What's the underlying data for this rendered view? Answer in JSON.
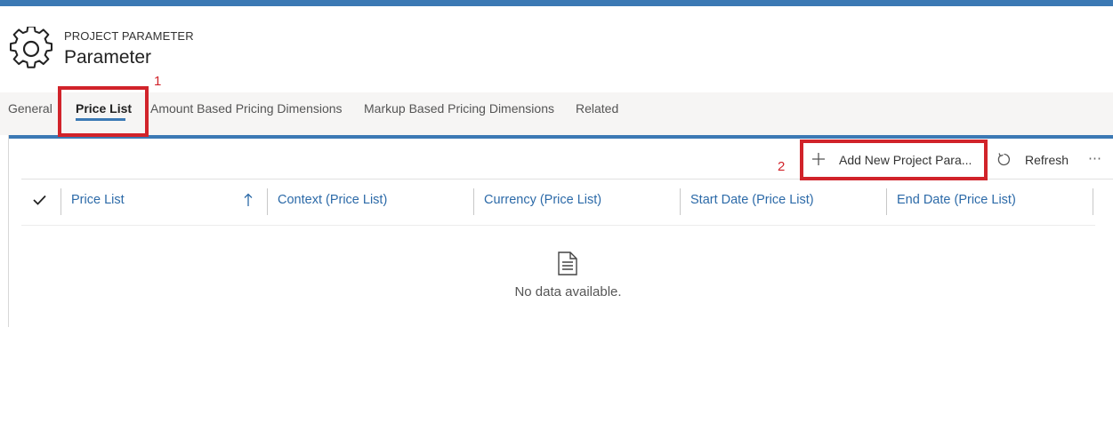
{
  "header": {
    "entity_type": "PROJECT PARAMETER",
    "entity_name": "Parameter",
    "icon": "gear-icon"
  },
  "tabs": [
    {
      "label": "General",
      "active": false
    },
    {
      "label": "Price List",
      "active": true
    },
    {
      "label": "Amount Based Pricing Dimensions",
      "active": false
    },
    {
      "label": "Markup Based Pricing Dimensions",
      "active": false
    },
    {
      "label": "Related",
      "active": false
    }
  ],
  "command_bar": {
    "add_label": "Add New Project Para...",
    "refresh_label": "Refresh",
    "more_label": "⋯"
  },
  "grid": {
    "columns": [
      {
        "label": "Price List",
        "sort": "ascending"
      },
      {
        "label": "Context (Price List)"
      },
      {
        "label": "Currency (Price List)"
      },
      {
        "label": "Start Date (Price List)"
      },
      {
        "label": "End Date (Price List)"
      }
    ],
    "empty_message": "No data available."
  },
  "annotations": [
    "1",
    "2"
  ],
  "colors": {
    "accent": "#3b79b4",
    "annotation": "#d1232a",
    "column_header": "#2c6aa8",
    "tab_bar_bg": "#f6f5f4"
  }
}
